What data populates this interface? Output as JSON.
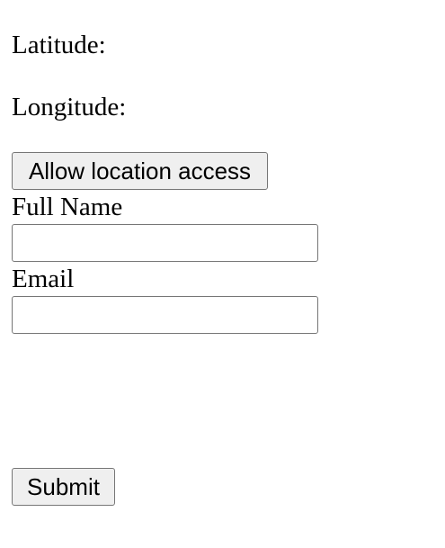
{
  "location": {
    "latitude_label": "Latitude:",
    "latitude_value": "",
    "longitude_label": "Longitude:",
    "longitude_value": "",
    "allow_button_label": "Allow location access"
  },
  "form": {
    "full_name_label": "Full Name",
    "full_name_value": "",
    "email_label": "Email",
    "email_value": "",
    "submit_label": "Submit"
  }
}
